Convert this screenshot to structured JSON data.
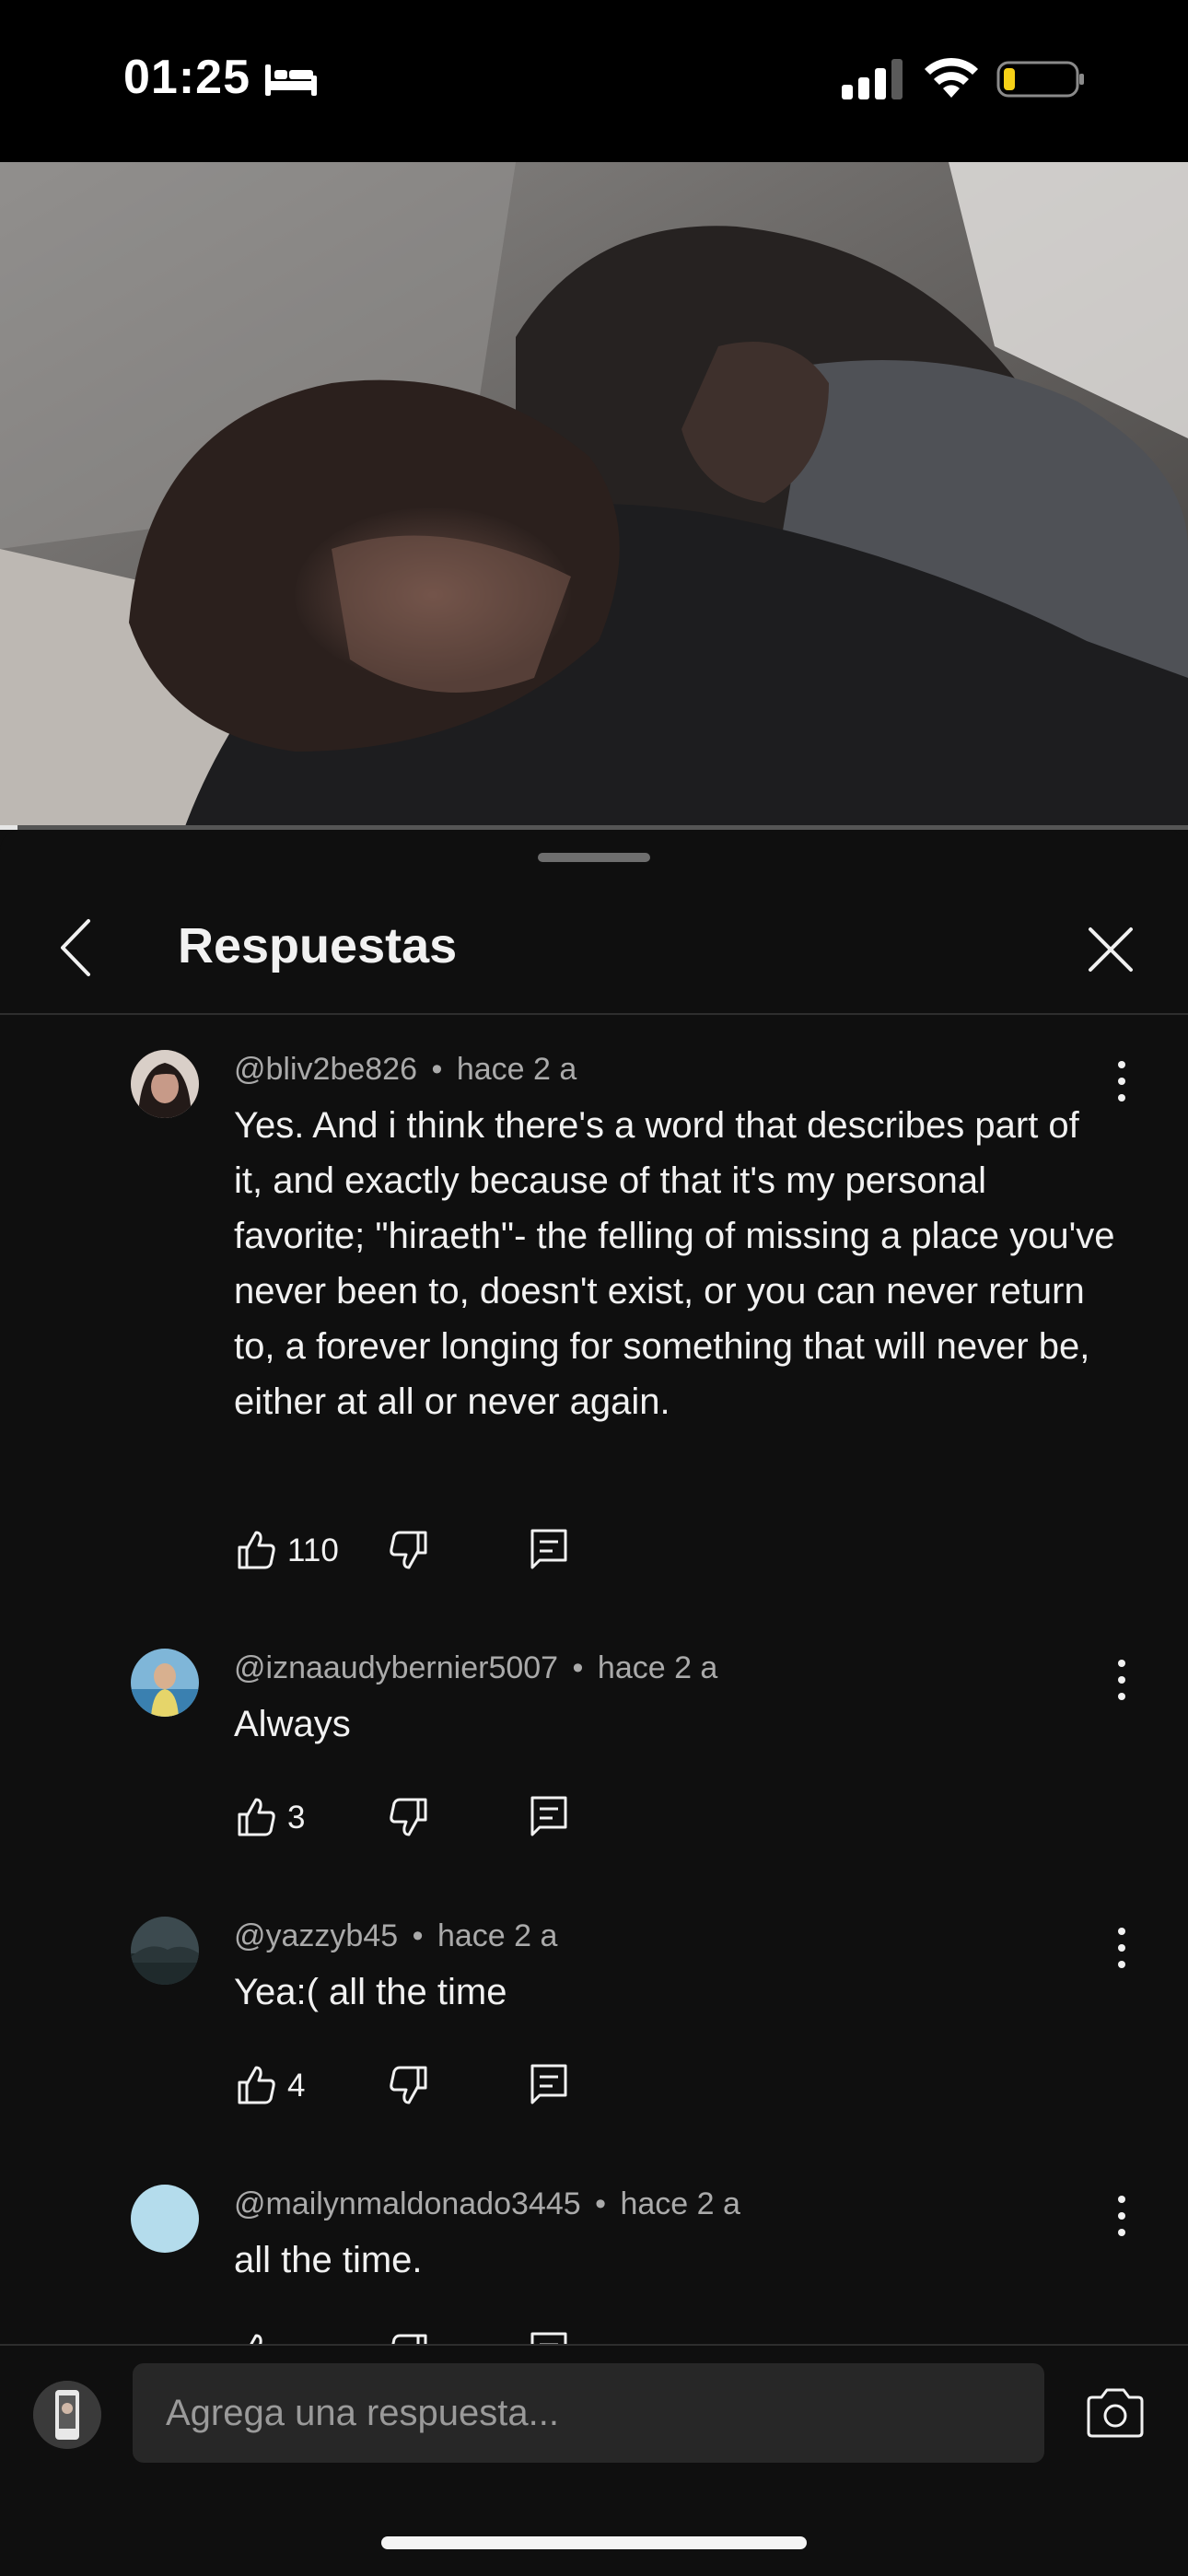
{
  "status_bar": {
    "time": "01:25",
    "sleep_icon": "bed-icon",
    "signal_icon": "cellular-signal-icon",
    "wifi_icon": "wifi-icon",
    "battery_icon": "battery-icon",
    "battery_color": "#f7d117"
  },
  "video": {
    "progress_fraction": 0.015
  },
  "header": {
    "title": "Respuestas",
    "back_icon": "chevron-left-icon",
    "close_icon": "close-icon"
  },
  "comments": [
    {
      "author": "@bliv2be826",
      "time": "hace 2 a",
      "text": "Yes. And i think there's a word that describes part of it, and exactly because of that it's my personal favorite; \"hiraeth\"- the felling of missing a place you've never been to, doesn't exist, or you can never return to, a forever longing for something that will never be, either at all or never again.",
      "likes": "110"
    },
    {
      "author": "@iznaaudybernier5007",
      "time": "hace 2 a",
      "text": "Always",
      "likes": "3"
    },
    {
      "author": "@yazzyb45",
      "time": "hace 2 a",
      "text": "Yea:( all the time",
      "likes": "4"
    },
    {
      "author": "@mailynmaldonado3445",
      "time": "hace 2 a",
      "text": "all the time.",
      "likes": ""
    }
  ],
  "separator": "•",
  "reply_bar": {
    "placeholder": "Agrega una respuesta...",
    "camera_icon": "camera-icon"
  },
  "colors": {
    "background": "#0f0f0f",
    "text": "#f1f1f1",
    "secondary_text": "#aaaaaa",
    "input_bg": "#272727",
    "avatar_light_blue": "#b4dcec"
  }
}
